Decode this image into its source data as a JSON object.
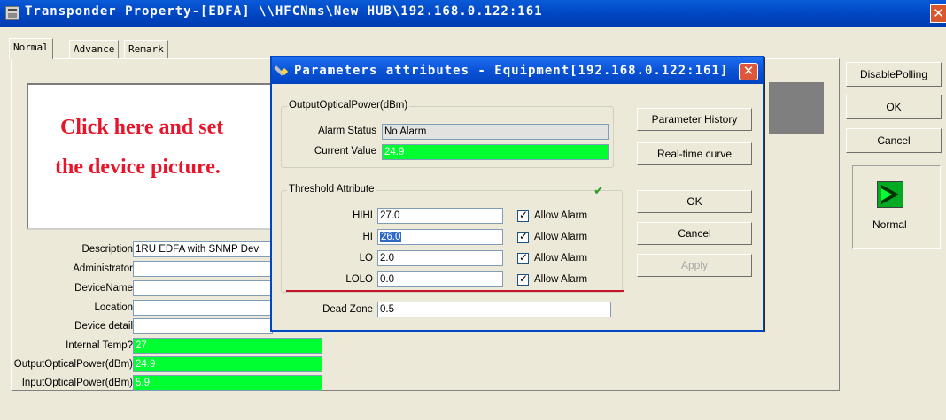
{
  "window": {
    "title": "Transponder Property-[EDFA] \\\\HFCNms\\New HUB\\192.168.0.122:161",
    "close_glyph": "✕"
  },
  "tabs": [
    {
      "label": "Normal",
      "active": true
    },
    {
      "label": "Advance",
      "active": false
    },
    {
      "label": "Remark",
      "active": false
    }
  ],
  "picture": {
    "line1": "Click here and set",
    "line2": "the device picture."
  },
  "fields": [
    {
      "label": "Description",
      "value": "1RU EDFA with SNMP Dev"
    },
    {
      "label": "Administrator",
      "value": ""
    },
    {
      "label": "DeviceName",
      "value": ""
    },
    {
      "label": "Location",
      "value": ""
    },
    {
      "label": "Device detail",
      "value": ""
    },
    {
      "label": "Internal Temp?",
      "value": "27"
    },
    {
      "label": "OutputOpticalPower(dBm)",
      "value": "24.9"
    },
    {
      "label": "InputOpticalPower(dBm)",
      "value": "5.9"
    }
  ],
  "right_buttons": {
    "disable_polling": "DisablePolling",
    "ok": "OK",
    "cancel": "Cancel"
  },
  "status": {
    "label": "Normal",
    "icon": "running-status-icon"
  },
  "dialog": {
    "title": "Parameters attributes - Equipment[192.168.0.122:161]",
    "close_glyph": "✕",
    "group1": {
      "title": "OutputOpticalPower(dBm)",
      "alarm_status_label": "Alarm Status",
      "alarm_status_value": "No Alarm",
      "current_value_label": "Current Value",
      "current_value": "24.9"
    },
    "group2": {
      "title": "Threshold Attribute",
      "rows": [
        {
          "label": "HIHI",
          "value": "27.0",
          "checkbox": "Allow Alarm",
          "checked": true
        },
        {
          "label": "HI",
          "value": "26.0",
          "checkbox": "Allow Alarm",
          "checked": true
        },
        {
          "label": "LO",
          "value": "2.0",
          "checkbox": "Allow Alarm",
          "checked": true
        },
        {
          "label": "LOLO",
          "value": "0.0",
          "checkbox": "Allow Alarm",
          "checked": true
        }
      ],
      "dead_zone_label": "Dead Zone",
      "dead_zone_value": "0.5"
    },
    "buttons": {
      "parameter_history": "Parameter History",
      "realtime_curve": "Real-time curve",
      "ok": "OK",
      "cancel": "Cancel",
      "apply": "Apply"
    }
  },
  "colors": {
    "titlebar": "#0047c4",
    "value_green": "#00ff30",
    "picture_text": "#e8152a"
  }
}
